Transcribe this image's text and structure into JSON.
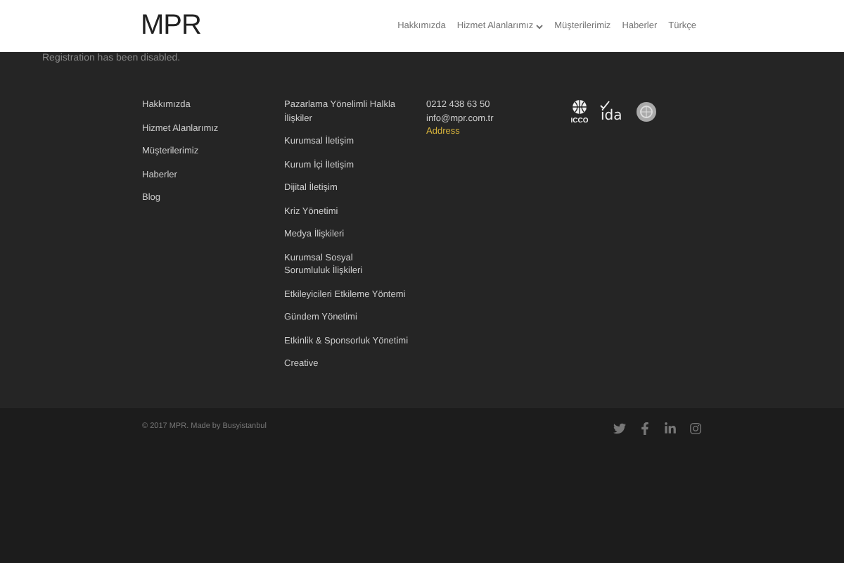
{
  "header": {
    "logo": "MPR",
    "nav": [
      {
        "label": "Hakkımızda",
        "dropdown": false
      },
      {
        "label": "Hizmet Alanlarımız",
        "dropdown": true
      },
      {
        "label": "Müşterilerimiz",
        "dropdown": false
      },
      {
        "label": "Haberler",
        "dropdown": false
      },
      {
        "label": "Türkçe",
        "dropdown": false
      }
    ]
  },
  "notice": "Registration has been disabled.",
  "footer": {
    "links": [
      "Hakkımızda",
      "Hizmet Alanlarımız",
      "Müşterilerimiz",
      "Haberler",
      "Blog"
    ],
    "services": [
      "Pazarlama Yönelimli Halkla İlişkiler",
      "Kurumsal İletişim",
      "Kurum İçi İletişim",
      "Dijital İletişim",
      "Kriz Yönetimi",
      "Medya İlişkileri",
      "Kurumsal Sosyal Sorumluluk İlişkileri",
      "Etkileyicileri Etkileme Yöntemi",
      "Gündem Yönetimi",
      "Etkinlik & Sponsorluk Yönetimi",
      "Creative"
    ],
    "contact": [
      {
        "text": "0212 438 63 50",
        "kind": "plain"
      },
      {
        "text": "info@mpr.com.tr",
        "kind": "plain"
      },
      {
        "text": "Address",
        "kind": "link"
      }
    ],
    "partner_logos": [
      {
        "kind": "globe",
        "text": "ICCO"
      },
      {
        "kind": "check",
        "text": "ida"
      },
      {
        "kind": "emblem"
      }
    ]
  },
  "bottom": {
    "copyright": "© 2017 MPR. Made by Busyistanbul",
    "social": [
      {
        "kind": "twitter"
      },
      {
        "kind": "facebook"
      },
      {
        "kind": "linkedin"
      },
      {
        "kind": "instagram"
      }
    ]
  }
}
